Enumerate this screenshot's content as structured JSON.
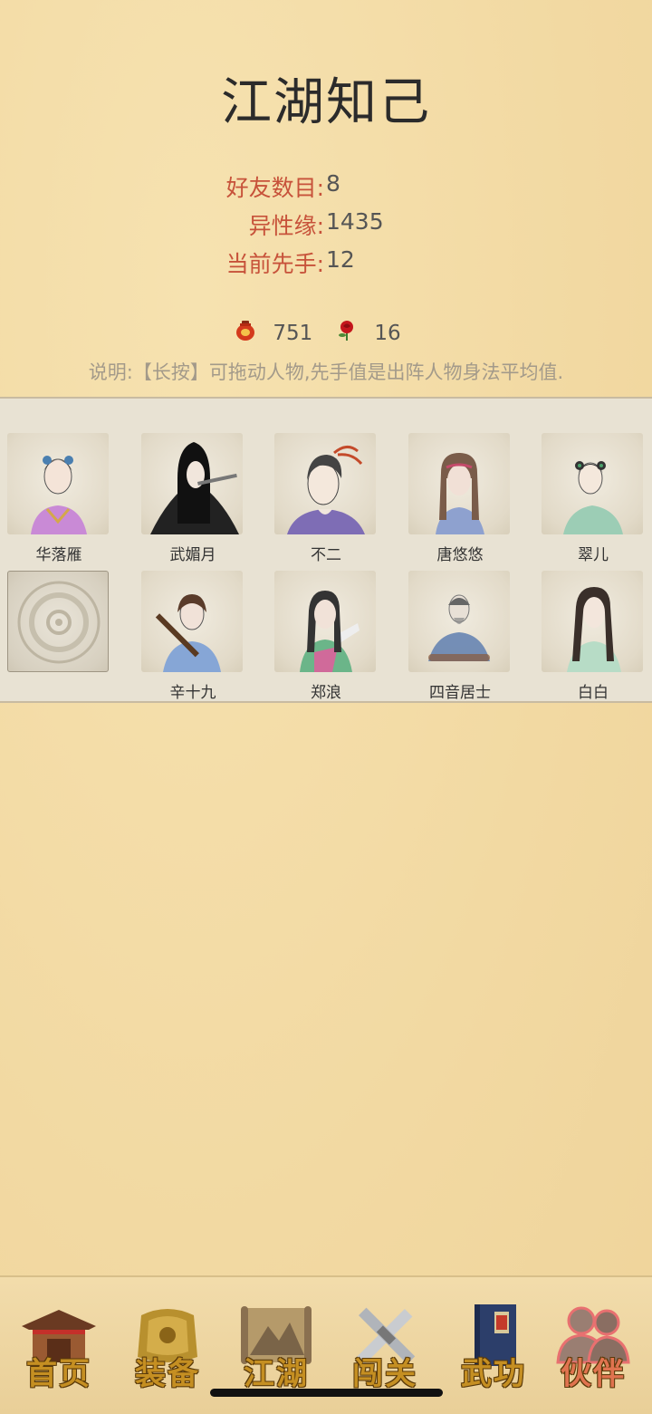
{
  "page": {
    "title": "江湖知己"
  },
  "stats": [
    {
      "label": "好友数目:",
      "value": "8"
    },
    {
      "label": "异性缘:",
      "value": "1435"
    },
    {
      "label": "当前先手:",
      "value": "12"
    }
  ],
  "currency": {
    "wine": {
      "icon": "wine-jar-icon",
      "value": "751"
    },
    "rose": {
      "icon": "rose-icon",
      "value": "16"
    }
  },
  "note": "说明:【长按】可拖动人物,先手值是出阵人物身法平均值.",
  "companions": [
    {
      "name": "华落雁",
      "robe": "#c98ad6",
      "hair": "#333"
    },
    {
      "name": "武媚月",
      "robe": "#222",
      "hair": "#111"
    },
    {
      "name": "不二",
      "robe": "#7e6db5",
      "hair": "#444"
    },
    {
      "name": "唐悠悠",
      "robe": "#8ea1cf",
      "hair": "#7a5c4a"
    },
    {
      "name": "翠儿",
      "robe": "#9ccdb5",
      "hair": "#333"
    },
    {
      "name": "",
      "robe": "",
      "hair": ""
    },
    {
      "name": "辛十九",
      "robe": "#86a6d6",
      "hair": "#5a3b2a"
    },
    {
      "name": "郑浪",
      "robe": "#6bb589",
      "hair": "#333"
    },
    {
      "name": "四音居士",
      "robe": "#5f7fb0",
      "hair": "#666"
    },
    {
      "name": "白白",
      "robe": "#b7dcc6",
      "hair": "#3a2f2a"
    }
  ],
  "nav": [
    {
      "label": "首页",
      "icon": "pavilion-icon",
      "active": false
    },
    {
      "label": "装备",
      "icon": "armor-icon",
      "active": false
    },
    {
      "label": "江湖",
      "icon": "scroll-map-icon",
      "active": false
    },
    {
      "label": "闯关",
      "icon": "crossed-swords-icon",
      "active": false
    },
    {
      "label": "武功",
      "icon": "book-icon",
      "active": false
    },
    {
      "label": "伙伴",
      "icon": "companions-icon",
      "active": true
    }
  ]
}
